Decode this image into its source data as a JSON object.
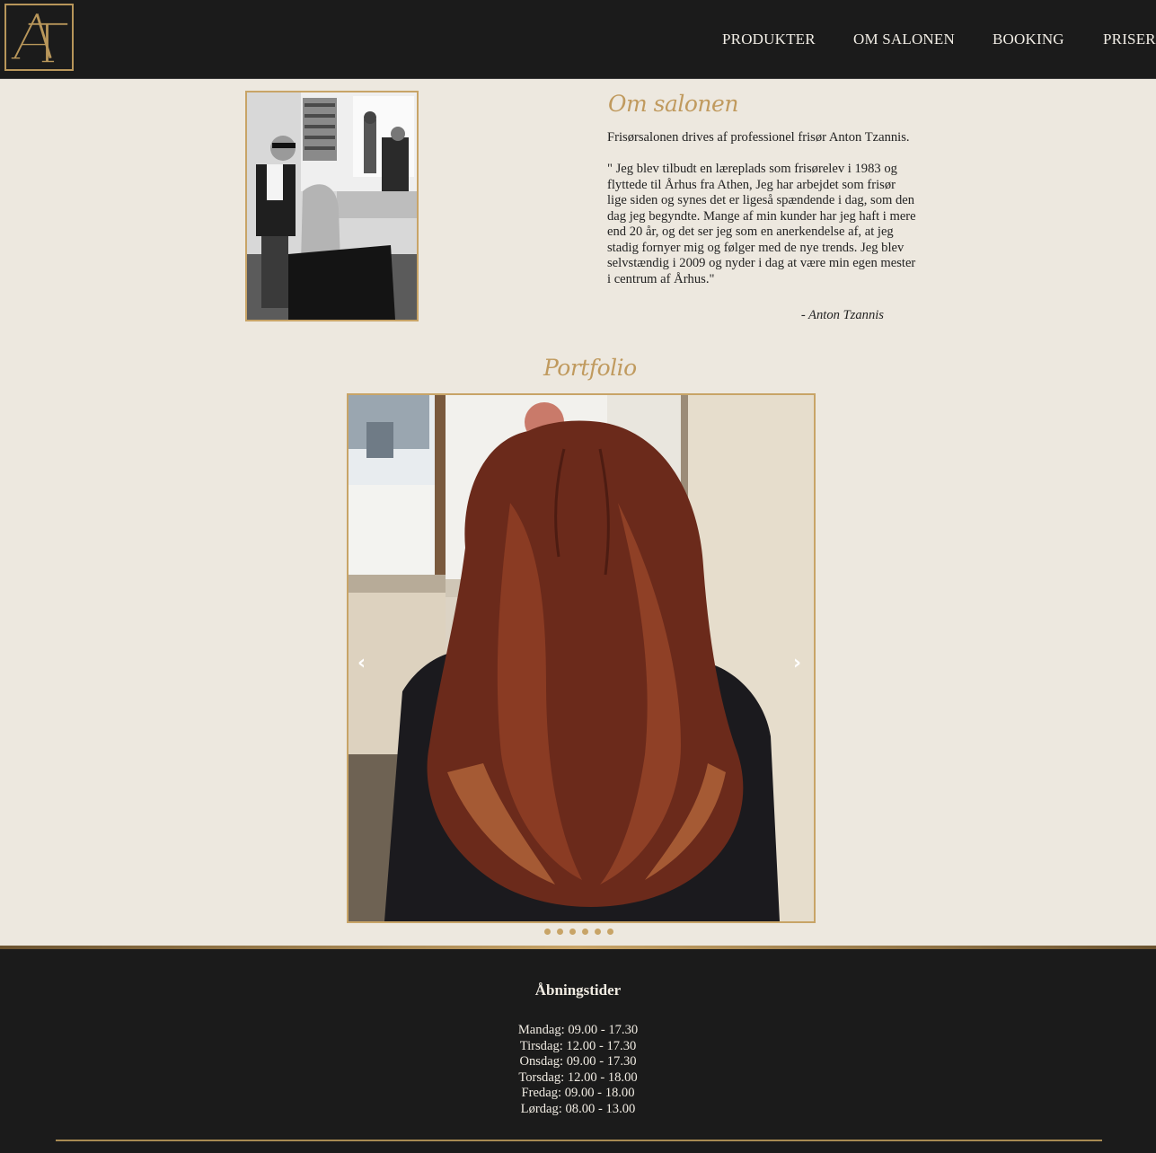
{
  "header": {
    "logo_alt": "AT",
    "nav": [
      {
        "label": "PRODUKTER"
      },
      {
        "label": "OM SALONEN"
      },
      {
        "label": "BOOKING"
      },
      {
        "label": "PRISER"
      }
    ]
  },
  "about": {
    "title": "Om salonen",
    "intro": "Frisørsalonen drives af professionel frisør Anton Tzannis.",
    "quote": "\" Jeg blev tilbudt en læreplads som frisørelev i 1983 og flyttede til Århus fra Athen, Jeg har arbejdet som frisør lige siden og synes det er ligeså spændende i dag, som den dag jeg begyndte. Mange af min kunder har jeg haft i mere end 20 år, og det ser jeg som en anerkendelse af, at jeg stadig fornyer mig og følger med de nye trends. Jeg blev selvstændig i 2009 og nyder i dag at være min egen mester i centrum af Århus.\"",
    "signature": "- Anton Tzannis"
  },
  "portfolio": {
    "title": "Portfolio",
    "prev_icon": "‹",
    "next_icon": "›",
    "slide_count": 6,
    "active_slide": 1
  },
  "footer": {
    "title": "Åbningstider",
    "hours": [
      "Mandag: 09.00 - 17.30",
      "Tirsdag: 12.00 - 17.30",
      "Onsdag: 09.00 - 17.30",
      "Torsdag: 12.00 - 18.00",
      "Fredag: 09.00 - 18.00",
      "Lørdag: 08.00 - 13.00"
    ]
  },
  "colors": {
    "gold": "#c8a467",
    "dark": "#1b1b1b",
    "background": "#ede8df"
  }
}
